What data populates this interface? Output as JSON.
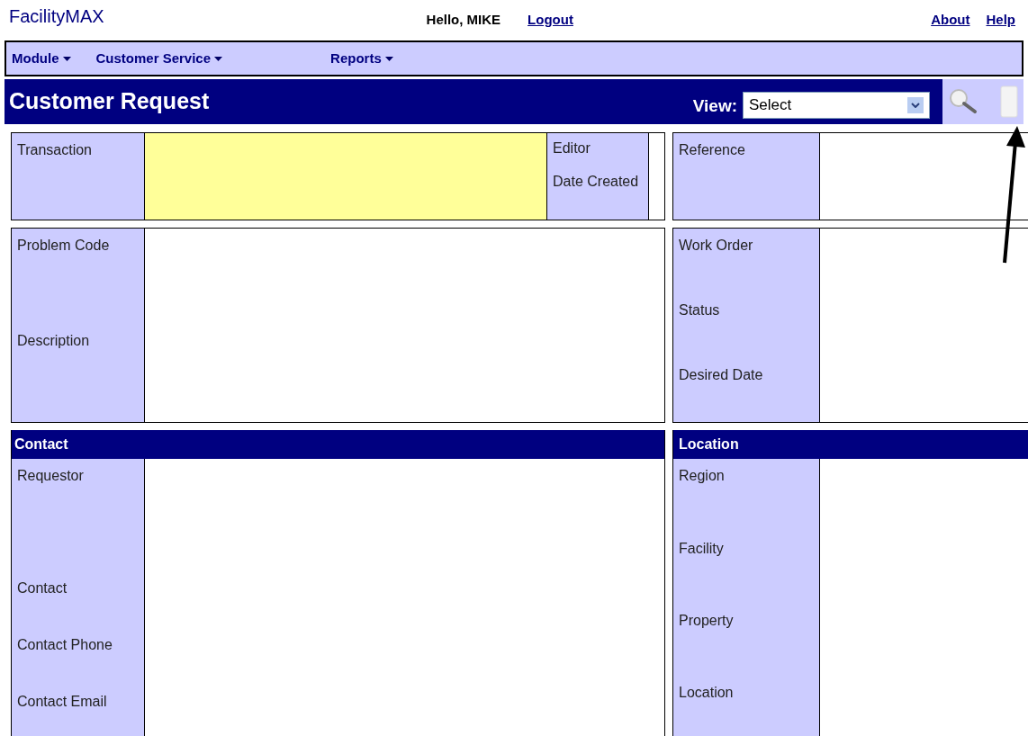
{
  "header": {
    "logo": "FacilityMAX",
    "greeting": "Hello, MIKE",
    "logout": "Logout",
    "links": [
      "About",
      "Help"
    ]
  },
  "menu": [
    {
      "label": "Module"
    },
    {
      "label": "Customer Service"
    },
    {
      "label": "Reports"
    }
  ],
  "title_bar": {
    "title": "Customer Request",
    "view_label": "View:",
    "view_value": "Select"
  },
  "transaction": {
    "label": "Transaction",
    "highlighted": true,
    "side_labels": [
      "Editor",
      "Date Created"
    ]
  },
  "reference": {
    "labels": [
      "Reference"
    ]
  },
  "problem": {
    "labels": [
      "Problem Code",
      "Description"
    ]
  },
  "work_order": {
    "labels": [
      "Work Order",
      "Status",
      "Desired Date"
    ]
  },
  "contact": {
    "heading": "Contact",
    "labels": [
      "Requestor",
      "Contact",
      "Contact Phone",
      "Contact Email"
    ]
  },
  "location": {
    "heading": "Location",
    "labels": [
      "Region",
      "Facility",
      "Property",
      "Location"
    ]
  }
}
